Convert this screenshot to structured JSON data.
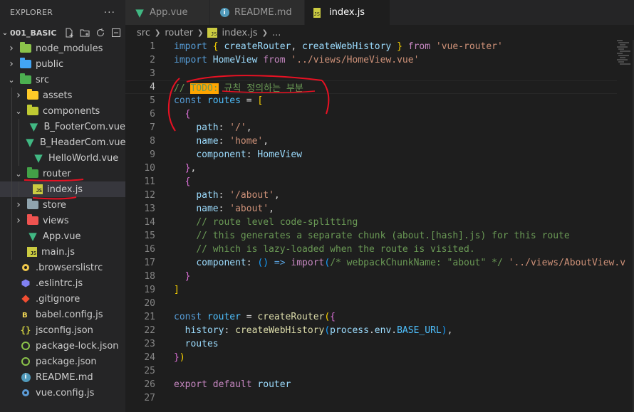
{
  "explorer": {
    "title": "EXPLORER",
    "more": "···",
    "project": "001_BASIC",
    "items": [
      {
        "label": "node_modules",
        "type": "folder",
        "color": "#8bc34a",
        "expanded": false,
        "depth": 1
      },
      {
        "label": "public",
        "type": "folder",
        "color": "#42a5f5",
        "expanded": false,
        "depth": 1
      },
      {
        "label": "src",
        "type": "folder",
        "color": "#4caf50",
        "expanded": true,
        "depth": 1
      },
      {
        "label": "assets",
        "type": "folder",
        "color": "#ffca28",
        "expanded": false,
        "depth": 2
      },
      {
        "label": "components",
        "type": "folder",
        "color": "#c0ca33",
        "expanded": true,
        "depth": 2
      },
      {
        "label": "B_FooterCom.vue",
        "type": "vue",
        "depth": 3
      },
      {
        "label": "B_HeaderCom.vue",
        "type": "vue",
        "depth": 3
      },
      {
        "label": "HelloWorld.vue",
        "type": "vue",
        "depth": 3
      },
      {
        "label": "router",
        "type": "folder",
        "color": "#43a047",
        "expanded": true,
        "depth": 2
      },
      {
        "label": "index.js",
        "type": "js",
        "depth": 3,
        "selected": true
      },
      {
        "label": "store",
        "type": "folder",
        "color": "#90a4ae",
        "expanded": false,
        "depth": 2
      },
      {
        "label": "views",
        "type": "folder",
        "color": "#ef5350",
        "expanded": false,
        "depth": 2
      },
      {
        "label": "App.vue",
        "type": "vue",
        "depth": 2
      },
      {
        "label": "main.js",
        "type": "js",
        "depth": 2
      },
      {
        "label": ".browserslistrc",
        "type": "browsers",
        "depth": 1
      },
      {
        "label": ".eslintrc.js",
        "type": "eslint",
        "depth": 1
      },
      {
        "label": ".gitignore",
        "type": "git",
        "depth": 1
      },
      {
        "label": "babel.config.js",
        "type": "babel",
        "depth": 1
      },
      {
        "label": "jsconfig.json",
        "type": "json",
        "depth": 1
      },
      {
        "label": "package-lock.json",
        "type": "npm",
        "depth": 1
      },
      {
        "label": "package.json",
        "type": "npm",
        "depth": 1
      },
      {
        "label": "README.md",
        "type": "info",
        "depth": 1
      },
      {
        "label": "vue.config.js",
        "type": "vueconfig",
        "depth": 1
      }
    ]
  },
  "tabs": [
    {
      "label": "App.vue",
      "icon": "vue-icon",
      "active": false
    },
    {
      "label": "README.md",
      "icon": "info-icon",
      "active": false
    },
    {
      "label": "index.js",
      "icon": "js-icon",
      "active": true,
      "dirty": true
    }
  ],
  "breadcrumb": {
    "seg1": "src",
    "seg2": "router",
    "seg3": "index.js",
    "seg4": "..."
  },
  "editor": {
    "current_line": 4,
    "lines": [
      [
        [
          "kw",
          "import"
        ],
        [
          "code",
          " "
        ],
        [
          "br1",
          "{"
        ],
        [
          "code",
          " "
        ],
        [
          "var",
          "createRouter"
        ],
        [
          "code",
          ", "
        ],
        [
          "var",
          "createWebHistory"
        ],
        [
          "code",
          " "
        ],
        [
          "br1",
          "}"
        ],
        [
          "code",
          " "
        ],
        [
          "ctl",
          "from"
        ],
        [
          "code",
          " "
        ],
        [
          "str",
          "'vue-router'"
        ]
      ],
      [
        [
          "kw",
          "import"
        ],
        [
          "code",
          " "
        ],
        [
          "var",
          "HomeView"
        ],
        [
          "code",
          " "
        ],
        [
          "ctl",
          "from"
        ],
        [
          "code",
          " "
        ],
        [
          "str",
          "'../views/HomeView.vue'"
        ]
      ],
      [],
      [
        [
          "cmt",
          "// "
        ],
        [
          "todo",
          "TODO:"
        ],
        [
          "cmt",
          " 규칙 정의하는 부분"
        ]
      ],
      [
        [
          "kw",
          "const"
        ],
        [
          "code",
          " "
        ],
        [
          "const",
          "routes"
        ],
        [
          "code",
          " = "
        ],
        [
          "br1",
          "["
        ]
      ],
      [
        [
          "code",
          "  "
        ],
        [
          "br2",
          "{"
        ]
      ],
      [
        [
          "code",
          "    "
        ],
        [
          "var",
          "path"
        ],
        [
          "code",
          ": "
        ],
        [
          "str",
          "'/'"
        ],
        [
          "code",
          ","
        ]
      ],
      [
        [
          "code",
          "    "
        ],
        [
          "var",
          "name"
        ],
        [
          "code",
          ": "
        ],
        [
          "str",
          "'home'"
        ],
        [
          "code",
          ","
        ]
      ],
      [
        [
          "code",
          "    "
        ],
        [
          "var",
          "component"
        ],
        [
          "code",
          ": "
        ],
        [
          "var",
          "HomeView"
        ]
      ],
      [
        [
          "code",
          "  "
        ],
        [
          "br2",
          "}"
        ],
        [
          "code",
          ","
        ]
      ],
      [
        [
          "code",
          "  "
        ],
        [
          "br2",
          "{"
        ]
      ],
      [
        [
          "code",
          "    "
        ],
        [
          "var",
          "path"
        ],
        [
          "code",
          ": "
        ],
        [
          "str",
          "'/about'"
        ],
        [
          "code",
          ","
        ]
      ],
      [
        [
          "code",
          "    "
        ],
        [
          "var",
          "name"
        ],
        [
          "code",
          ": "
        ],
        [
          "str",
          "'about'"
        ],
        [
          "code",
          ","
        ]
      ],
      [
        [
          "code",
          "    "
        ],
        [
          "cmt",
          "// route level code-splitting"
        ]
      ],
      [
        [
          "code",
          "    "
        ],
        [
          "cmt",
          "// this generates a separate chunk (about.[hash].js) for this route"
        ]
      ],
      [
        [
          "code",
          "    "
        ],
        [
          "cmt",
          "// which is lazy-loaded when the route is visited."
        ]
      ],
      [
        [
          "code",
          "    "
        ],
        [
          "var",
          "component"
        ],
        [
          "code",
          ": "
        ],
        [
          "br3",
          "()"
        ],
        [
          "code",
          " "
        ],
        [
          "kw",
          "=>"
        ],
        [
          "code",
          " "
        ],
        [
          "ctl",
          "import"
        ],
        [
          "br3",
          "("
        ],
        [
          "cmt",
          "/* webpackChunkName: \"about\" */"
        ],
        [
          "code",
          " "
        ],
        [
          "str",
          "'../views/AboutView.v"
        ]
      ],
      [
        [
          "code",
          "  "
        ],
        [
          "br2",
          "}"
        ]
      ],
      [
        [
          "br1",
          "]"
        ]
      ],
      [],
      [
        [
          "kw",
          "const"
        ],
        [
          "code",
          " "
        ],
        [
          "const",
          "router"
        ],
        [
          "code",
          " = "
        ],
        [
          "fn",
          "createRouter"
        ],
        [
          "br1",
          "("
        ],
        [
          "br2",
          "{"
        ]
      ],
      [
        [
          "code",
          "  "
        ],
        [
          "var",
          "history"
        ],
        [
          "code",
          ": "
        ],
        [
          "fn",
          "createWebHistory"
        ],
        [
          "br3",
          "("
        ],
        [
          "var",
          "process"
        ],
        [
          "code",
          "."
        ],
        [
          "var",
          "env"
        ],
        [
          "code",
          "."
        ],
        [
          "const",
          "BASE_URL"
        ],
        [
          "br3",
          ")"
        ],
        [
          "code",
          ","
        ]
      ],
      [
        [
          "code",
          "  "
        ],
        [
          "var",
          "routes"
        ]
      ],
      [
        [
          "br2",
          "}"
        ],
        [
          "br1",
          ")"
        ]
      ],
      [],
      [
        [
          "ctl",
          "export"
        ],
        [
          "code",
          " "
        ],
        [
          "ctl",
          "default"
        ],
        [
          "code",
          " "
        ],
        [
          "var",
          "router"
        ]
      ],
      []
    ]
  },
  "colors": {
    "annotation": "#e81123",
    "accent_js": "#cbcb41",
    "accent_vue": "#41b883"
  }
}
